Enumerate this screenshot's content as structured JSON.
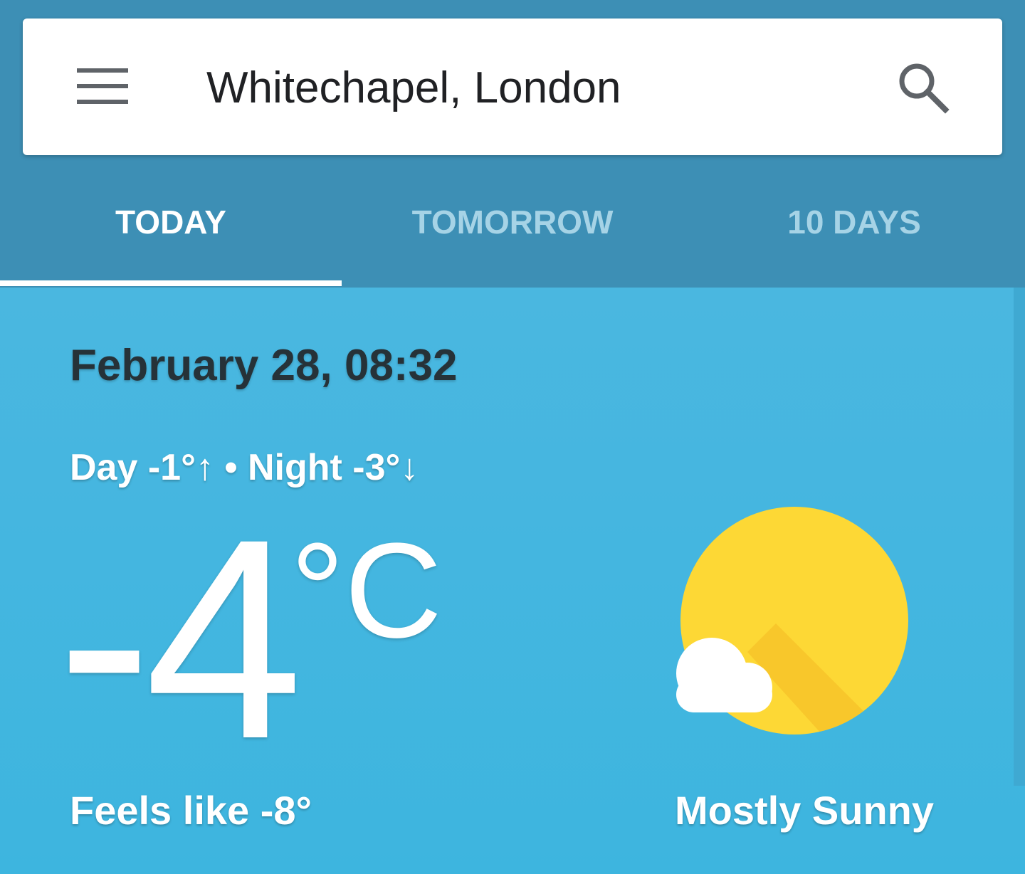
{
  "search": {
    "location": "Whitechapel, London",
    "menu_icon": "hamburger-menu-icon",
    "search_icon": "search-icon"
  },
  "tabs": [
    {
      "label": "TODAY",
      "active": true
    },
    {
      "label": "TOMORROW",
      "active": false
    },
    {
      "label": "10 DAYS",
      "active": false
    }
  ],
  "weather": {
    "datetime": "February 28, 08:32",
    "day_night": "Day -1°↑ • Night -3°↓",
    "temperature": "-4",
    "unit": "°C",
    "feels_like": "Feels like -8°",
    "condition": "Mostly Sunny",
    "condition_icon": "sun-with-cloud-icon"
  },
  "colors": {
    "header": "#3d8fb5",
    "panel": "#48b5df",
    "sun": "#fdd835",
    "tab_inactive": "#a6d3e6",
    "date_text": "#263238"
  }
}
